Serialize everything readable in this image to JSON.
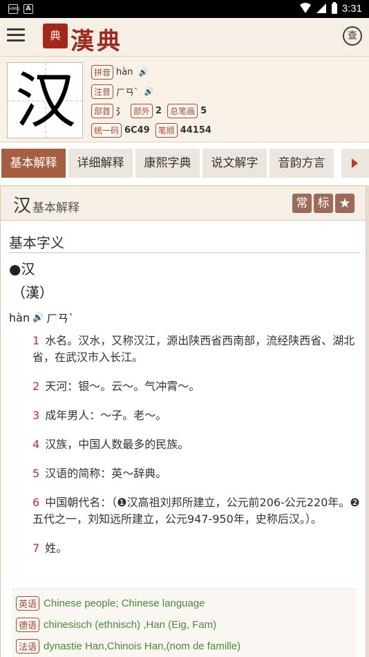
{
  "status_bar": {
    "time": "3:31",
    "left_icons": [
      "HMS",
      "A"
    ]
  },
  "header": {
    "logo_seal": "典",
    "logo_text": "漢典",
    "search_seal": "查"
  },
  "char_card": {
    "character": "汉",
    "rows": [
      {
        "label": "拼音",
        "value": "hàn",
        "speaker": true
      },
      {
        "label": "注音",
        "value": "ㄏㄢˋ",
        "speaker": true
      },
      {
        "label": "部首",
        "value": "氵",
        "label2": "部外",
        "value2": "2",
        "label3": "总笔画",
        "value3": "5"
      },
      {
        "label": "统一码",
        "value": "6C49",
        "label2": "笔顺",
        "value2": "44154"
      }
    ]
  },
  "tabs": [
    "基本解释",
    "详细解释",
    "康熙字典",
    "说文解字",
    "音韵方言"
  ],
  "panel": {
    "head_char": "汉",
    "head_title": "基本解释",
    "badges": [
      "常",
      "标"
    ],
    "section_title": "基本字义",
    "entry_head": "●汉",
    "entry_trad": "（漢）",
    "pron_pinyin": "hàn",
    "pron_zhuyin": "ㄏㄢˋ",
    "definitions": [
      {
        "num": "1",
        "text": "水名。汉水，又称汉江，源出陕西省西南部，流经陕西省、湖北省，在武汉市入长江。"
      },
      {
        "num": "2",
        "text": "天河：银～。云～。气冲霄～。"
      },
      {
        "num": "3",
        "text": "成年男人：～子。老～。"
      },
      {
        "num": "4",
        "text": "汉族，中国人数最多的民族。"
      },
      {
        "num": "5",
        "text": "汉语的简称：英～辞典。"
      },
      {
        "num": "6",
        "text": "中国朝代名：（❶汉高祖刘邦所建立，公元前206-公元220年。❷五代之一，刘知远所建立，公元947-950年，史称后汉。）。"
      },
      {
        "num": "7",
        "text": "姓。"
      }
    ],
    "foreign": [
      {
        "label": "英语",
        "text": "Chinese people; Chinese language"
      },
      {
        "label": "德语",
        "text": "chinesisch (ethnisch) ,Han (Eig, Fam)"
      },
      {
        "label": "法语",
        "text": "dynastie Han,Chinois Han,(nom de famille)"
      }
    ]
  }
}
